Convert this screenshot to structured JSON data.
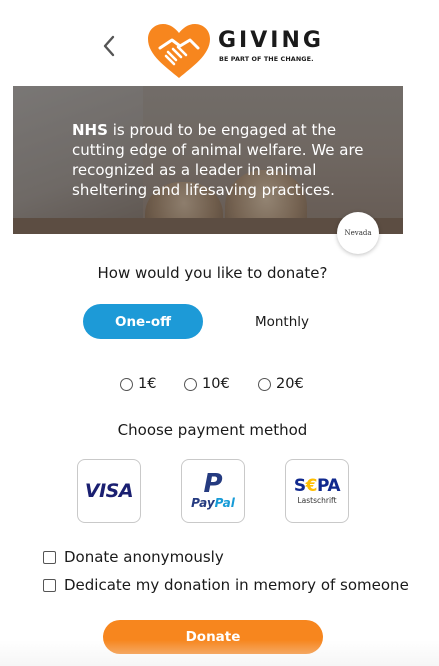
{
  "header": {
    "back_icon": "chevron-left-icon",
    "logo_icon": "heart-handshake-icon",
    "logo_word": "GIVING",
    "logo_tagline": "BE PART OF THE CHANGE.",
    "brand_color": "#f7861e"
  },
  "hero": {
    "org_name": "NHS",
    "description": " is proud to be engaged at the cutting edge of animal welfare. We are recognized as a leader in animal sheltering and lifesaving practices.",
    "partner_badge": "Nevada"
  },
  "donation": {
    "question": "How would you like to donate?",
    "frequency": {
      "selected": "One-off",
      "options": [
        "One-off",
        "Monthly"
      ],
      "active_color": "#1d9ad7"
    },
    "amounts": [
      "1€",
      "10€",
      "20€"
    ]
  },
  "payment": {
    "title": "Choose payment method",
    "methods": [
      {
        "name": "VISA"
      },
      {
        "name": "PayPal",
        "mark": "P",
        "word_a": "Pay",
        "word_b": "Pal"
      },
      {
        "name": "SEPA",
        "word_a": "S",
        "word_euro": "€",
        "word_b": "PA",
        "sub": "Lastschrift"
      }
    ]
  },
  "options": {
    "anonymous": "Donate anonymously",
    "memory": "Dedicate my donation in memory of someone"
  },
  "cta": {
    "label": "Donate",
    "color": "#f7861e"
  }
}
